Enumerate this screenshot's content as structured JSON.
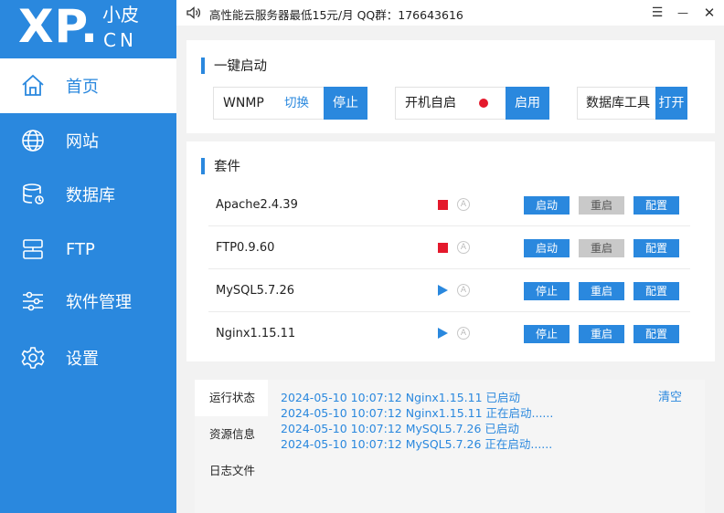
{
  "logo": {
    "brand": "XP.",
    "brand_cn": "小皮",
    "domain": "CN"
  },
  "sidebar": {
    "items": [
      {
        "label": "首页",
        "icon": "home-icon"
      },
      {
        "label": "网站",
        "icon": "globe-icon"
      },
      {
        "label": "数据库",
        "icon": "database-icon"
      },
      {
        "label": "FTP",
        "icon": "ftp-icon"
      },
      {
        "label": "软件管理",
        "icon": "sliders-icon"
      },
      {
        "label": "设置",
        "icon": "gear-icon"
      }
    ],
    "active_index": 0
  },
  "titlebar": {
    "ad_text": "高性能云服务器最低15元/月  QQ群：176643616",
    "menu_glyph": "☰",
    "minimize_glyph": "—",
    "close_glyph": "✕"
  },
  "quickstart": {
    "title": "一键启动",
    "wnmp_label": "WNMP",
    "switch_label": "切换",
    "stop_label": "停止",
    "autostart_label": "开机自启",
    "enable_label": "启用",
    "db_tool_label": "数据库工具",
    "open_label": "打开"
  },
  "suite": {
    "title": "套件",
    "rows": [
      {
        "name": "Apache2.4.39",
        "status": "stopped",
        "auto": "A",
        "btn1": "启动",
        "btn2": "重启",
        "btn3": "配置"
      },
      {
        "name": "FTP0.9.60",
        "status": "stopped",
        "auto": "A",
        "btn1": "启动",
        "btn2": "重启",
        "btn3": "配置"
      },
      {
        "name": "MySQL5.7.26",
        "status": "running",
        "auto": "A",
        "btn1": "停止",
        "btn2": "重启",
        "btn3": "配置"
      },
      {
        "name": "Nginx1.15.11",
        "status": "running",
        "auto": "A",
        "btn1": "停止",
        "btn2": "重启",
        "btn3": "配置"
      }
    ]
  },
  "log": {
    "tabs": [
      "运行状态",
      "资源信息",
      "日志文件"
    ],
    "active_tab": 0,
    "clear_label": "清空",
    "lines": [
      "2024-05-10 10:07:12 Nginx1.15.11 已启动",
      "2024-05-10 10:07:12 Nginx1.15.11 正在启动......",
      "2024-05-10 10:07:12 MySQL5.7.26 已启动",
      "2024-05-10 10:07:12 MySQL5.7.26 正在启动......"
    ]
  },
  "colors": {
    "accent": "#2a88de",
    "stopped": "#e4192c",
    "disabled_button": "#c9c9c9"
  }
}
